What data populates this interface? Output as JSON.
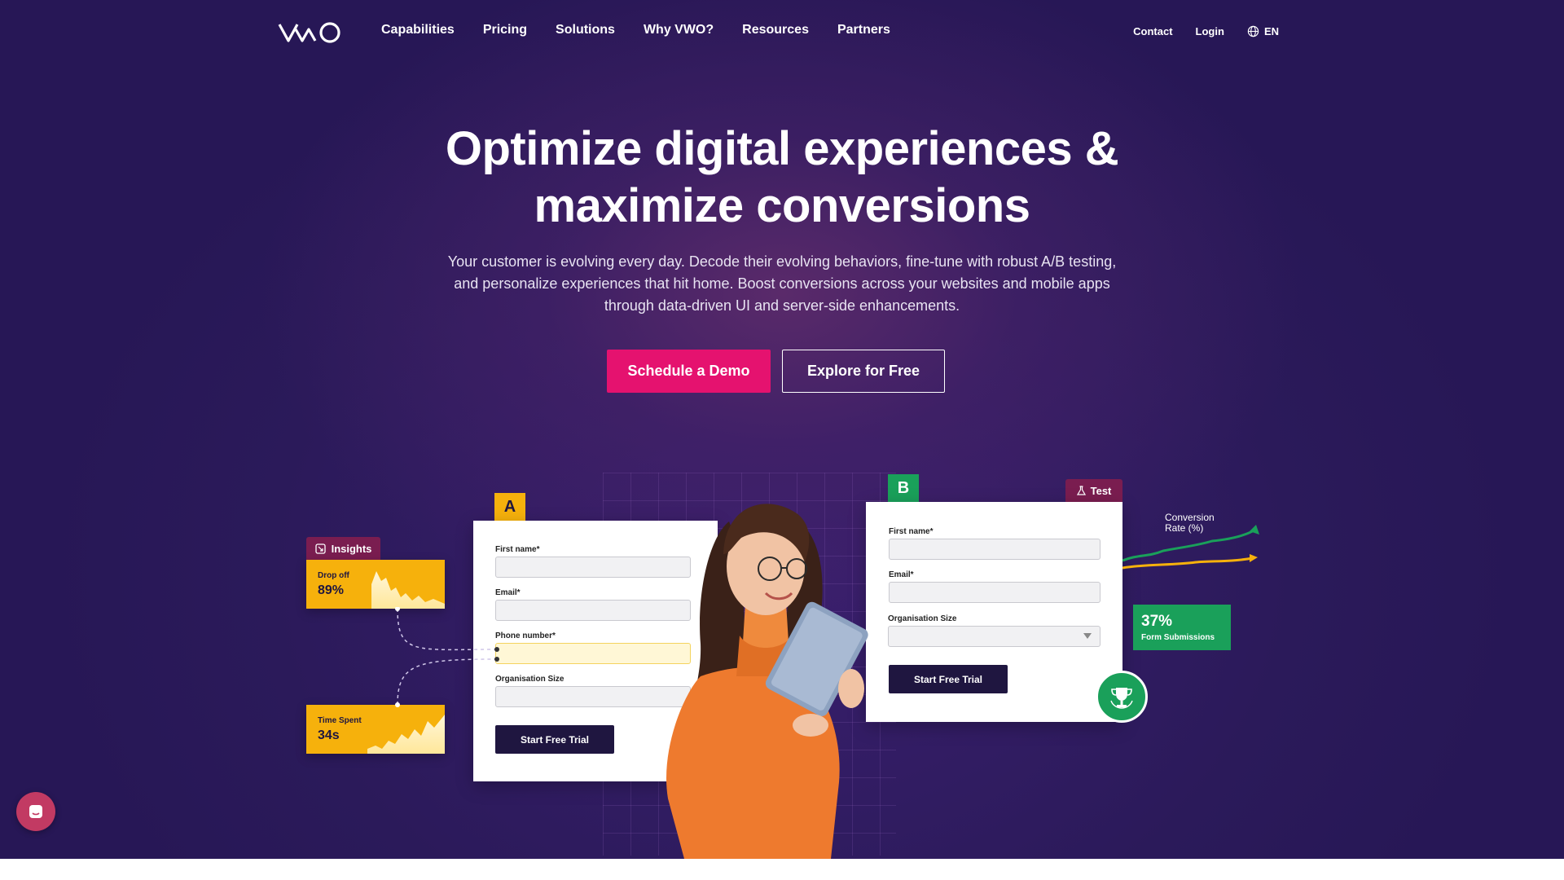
{
  "nav": {
    "logo_text": "VWO",
    "items": [
      "Capabilities",
      "Pricing",
      "Solutions",
      "Why VWO?",
      "Resources",
      "Partners"
    ],
    "contact": "Contact",
    "login": "Login",
    "lang": "EN"
  },
  "hero": {
    "headline_line1": "Optimize digital experiences &",
    "headline_line2": "maximize conversions",
    "sub_line1": "Your customer is evolving every day. Decode their evolving behaviors, fine-tune with robust A/B testing,",
    "sub_line2": "and personalize experiences that hit home. Boost conversions across your websites and mobile apps",
    "sub_line3": "through data-driven UI and server-side enhancements.",
    "cta_primary": "Schedule a Demo",
    "cta_secondary": "Explore for Free"
  },
  "illustration": {
    "variant_a": {
      "tag": "A",
      "fields": [
        "First name*",
        "Email*",
        "Phone number*",
        "Organisation Size"
      ],
      "button": "Start Free Trial"
    },
    "variant_b": {
      "tag": "B",
      "test_label": "Test",
      "fields": [
        "First name*",
        "Email*",
        "Organisation Size"
      ],
      "button": "Start Free Trial"
    },
    "insights": {
      "label": "Insights",
      "drop_off_label": "Drop off",
      "drop_off_value": "89%",
      "time_spent_label": "Time Spent",
      "time_spent_value": "34s"
    },
    "conversion_label_line1": "Conversion",
    "conversion_label_line2": "Rate (%)",
    "form_submissions_value": "37%",
    "form_submissions_label": "Form Submissions"
  },
  "colors": {
    "background": "#2e1c5e",
    "primary_button": "#e5126f",
    "accent_yellow": "#f6b10c",
    "accent_green": "#1aa05a",
    "tag_maroon": "#7a1d50"
  },
  "icons": {
    "globe": "globe-icon",
    "insights": "insights-icon",
    "test": "flask-icon",
    "trophy": "trophy-icon",
    "chat": "chat-icon"
  }
}
